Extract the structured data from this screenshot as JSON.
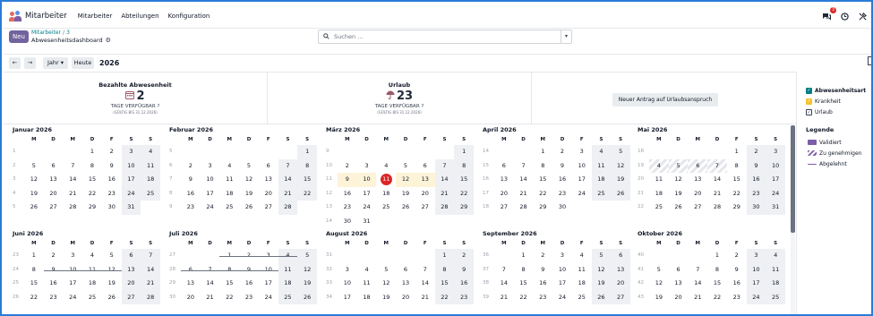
{
  "navbar": {
    "brand": "Mitarbeiter",
    "menu": [
      "Mitarbeiter",
      "Abteilungen",
      "Konfiguration"
    ],
    "messages_badge": "3"
  },
  "control_panel": {
    "new_label": "Neu",
    "breadcrumb_parent": "Mitarbeiter",
    "breadcrumb_sep": "/",
    "breadcrumb_id": "3",
    "title": "Abwesenheitsdashboard",
    "search_placeholder": "Suchen ..."
  },
  "toolbar": {
    "prev": "←",
    "next": "→",
    "scale": "Jahr",
    "today": "Heute",
    "year": "2026"
  },
  "summary": {
    "paid": {
      "title": "Bezahlte Abwesenheit",
      "value": "2",
      "sub": "TAGE VERFÜGBAR",
      "valid": "(GÜLTIG BIS 31.12.2026)"
    },
    "vacation": {
      "title": "Urlaub",
      "value": "23",
      "sub": "TAGE VERFÜGBAR",
      "valid": "(GÜLTIG BIS 31.12.2026)"
    },
    "claim_button": "Neuer Antrag auf Urlaubsanspruch"
  },
  "weekday_headers": [
    "M",
    "D",
    "M",
    "D",
    "F",
    "S",
    "S"
  ],
  "months": [
    {
      "title": "Januar 2026",
      "rows": [
        [
          "1",
          "",
          "",
          "",
          "1",
          "2",
          "3",
          "4"
        ],
        [
          "2",
          "5",
          "6",
          "7",
          "8",
          "9",
          "10",
          "11"
        ],
        [
          "3",
          "12",
          "13",
          "14",
          "15",
          "16",
          "17",
          "18"
        ],
        [
          "4",
          "19",
          "20",
          "21",
          "22",
          "23",
          "24",
          "25"
        ],
        [
          "5",
          "26",
          "27",
          "28",
          "29",
          "30",
          "31",
          ""
        ]
      ]
    },
    {
      "title": "Februar 2026",
      "rows": [
        [
          "5",
          "",
          "",
          "",
          "",
          "",
          "",
          "1"
        ],
        [
          "6",
          "2",
          "3",
          "4",
          "5",
          "6",
          "7",
          "8"
        ],
        [
          "7",
          "9",
          "10",
          "11",
          "12",
          "13",
          "14",
          "15"
        ],
        [
          "8",
          "16",
          "17",
          "18",
          "19",
          "20",
          "21",
          "22"
        ],
        [
          "9",
          "23",
          "24",
          "25",
          "26",
          "27",
          "28",
          ""
        ]
      ]
    },
    {
      "title": "März 2026",
      "rows": [
        [
          "9",
          "",
          "",
          "",
          "",
          "",
          "",
          "1"
        ],
        [
          "10",
          "2",
          "3",
          "4",
          "5",
          "6",
          "7",
          "8"
        ],
        [
          "11",
          "9",
          "10",
          "11",
          "12",
          "13",
          "14",
          "15"
        ],
        [
          "12",
          "16",
          "17",
          "18",
          "19",
          "20",
          "21",
          "22"
        ],
        [
          "13",
          "23",
          "24",
          "25",
          "26",
          "27",
          "28",
          "29"
        ],
        [
          "14",
          "30",
          "31",
          "",
          "",
          "",
          "",
          ""
        ]
      ]
    },
    {
      "title": "April 2026",
      "rows": [
        [
          "14",
          "",
          "",
          "1",
          "2",
          "3",
          "4",
          "5"
        ],
        [
          "15",
          "6",
          "7",
          "8",
          "9",
          "10",
          "11",
          "12"
        ],
        [
          "16",
          "13",
          "14",
          "15",
          "16",
          "17",
          "18",
          "19"
        ],
        [
          "17",
          "20",
          "21",
          "22",
          "23",
          "24",
          "25",
          "26"
        ],
        [
          "18",
          "27",
          "28",
          "29",
          "30",
          "",
          "",
          ""
        ]
      ]
    },
    {
      "title": "Mai 2026",
      "rows": [
        [
          "18",
          "",
          "",
          "",
          "",
          "1",
          "2",
          "3"
        ],
        [
          "19",
          "4",
          "5",
          "6",
          "7",
          "8",
          "9",
          "10"
        ],
        [
          "20",
          "11",
          "12",
          "13",
          "14",
          "15",
          "16",
          "17"
        ],
        [
          "21",
          "18",
          "19",
          "20",
          "21",
          "22",
          "23",
          "24"
        ],
        [
          "22",
          "25",
          "26",
          "27",
          "28",
          "29",
          "30",
          "31"
        ]
      ]
    },
    {
      "title": "Juni 2026",
      "rows": [
        [
          "23",
          "1",
          "2",
          "3",
          "4",
          "5",
          "6",
          "7"
        ],
        [
          "24",
          "8",
          "9",
          "10",
          "11",
          "12",
          "13",
          "14"
        ],
        [
          "25",
          "15",
          "16",
          "17",
          "18",
          "19",
          "20",
          "21"
        ],
        [
          "26",
          "22",
          "23",
          "24",
          "25",
          "26",
          "27",
          "28"
        ]
      ]
    },
    {
      "title": "Juli 2026",
      "rows": [
        [
          "27",
          "",
          "",
          "1",
          "2",
          "3",
          "4",
          "5"
        ],
        [
          "28",
          "6",
          "7",
          "8",
          "9",
          "10",
          "11",
          "12"
        ],
        [
          "29",
          "13",
          "14",
          "15",
          "16",
          "17",
          "18",
          "19"
        ],
        [
          "30",
          "20",
          "21",
          "22",
          "23",
          "24",
          "25",
          "26"
        ]
      ]
    },
    {
      "title": "August 2026",
      "rows": [
        [
          "31",
          "",
          "",
          "",
          "",
          "",
          "1",
          "2"
        ],
        [
          "32",
          "3",
          "4",
          "5",
          "6",
          "7",
          "8",
          "9"
        ],
        [
          "33",
          "10",
          "11",
          "12",
          "13",
          "14",
          "15",
          "16"
        ],
        [
          "34",
          "17",
          "18",
          "19",
          "20",
          "21",
          "22",
          "23"
        ]
      ]
    },
    {
      "title": "September 2026",
      "rows": [
        [
          "36",
          "",
          "1",
          "2",
          "3",
          "4",
          "5",
          "6"
        ],
        [
          "37",
          "7",
          "8",
          "9",
          "10",
          "11",
          "12",
          "13"
        ],
        [
          "38",
          "14",
          "15",
          "16",
          "17",
          "18",
          "19",
          "20"
        ],
        [
          "39",
          "21",
          "22",
          "23",
          "24",
          "25",
          "26",
          "27"
        ]
      ]
    },
    {
      "title": "Oktober 2026",
      "rows": [
        [
          "40",
          "",
          "",
          "",
          "1",
          "2",
          "3",
          "4"
        ],
        [
          "41",
          "5",
          "6",
          "7",
          "8",
          "9",
          "10",
          "11"
        ],
        [
          "42",
          "12",
          "13",
          "14",
          "15",
          "16",
          "17",
          "18"
        ],
        [
          "43",
          "19",
          "20",
          "21",
          "22",
          "23",
          "24",
          "25"
        ]
      ]
    }
  ],
  "legend": {
    "types": [
      {
        "label": "Abwesenheitsart",
        "color": "#017e84",
        "bold": true
      },
      {
        "label": "Krankheit",
        "color": "#f4c430"
      },
      {
        "label": "Urlaub",
        "color": "#ffffff"
      }
    ],
    "title": "Legende",
    "states": [
      {
        "label": "Validiert",
        "style": "solid",
        "color": "#7b5ea7"
      },
      {
        "label": "Zu genehmigen",
        "style": "hatched",
        "color": "#7b5ea7"
      },
      {
        "label": "Abgelehnt",
        "style": "line",
        "color": "#7b5ea7"
      }
    ]
  }
}
